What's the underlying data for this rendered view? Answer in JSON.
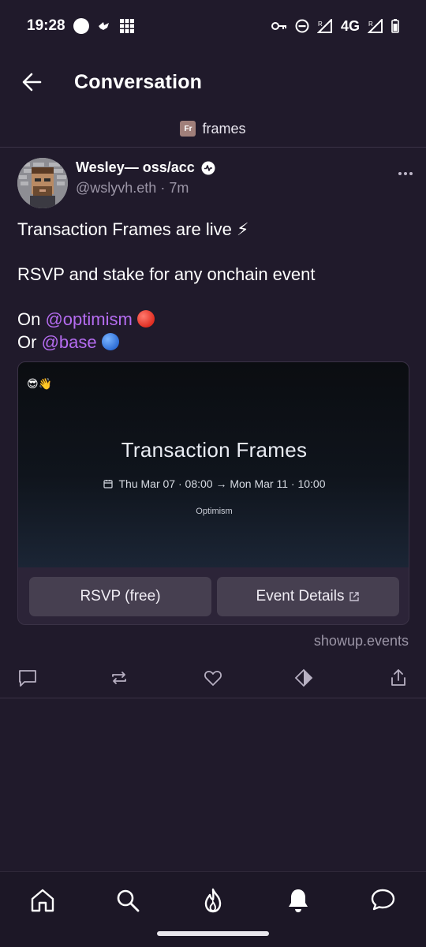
{
  "status_bar": {
    "time": "19:28",
    "network": "4G",
    "icons": [
      "circle-icon",
      "bird-icon",
      "grid-icon",
      "key-icon",
      "dnd-icon",
      "signal-icon",
      "signal-icon",
      "battery-icon"
    ]
  },
  "header": {
    "title": "Conversation",
    "back_icon": "arrow-left-icon"
  },
  "channel": {
    "badge": "Fr",
    "name": "frames"
  },
  "post": {
    "author_name": "Wesley— oss/acc",
    "author_handle": "@wslyvh.eth",
    "time_sep": " · ",
    "time_ago": "7m",
    "text_line1": "Transaction Frames are live ⚡",
    "text_line2": "RSVP and stake for any onchain event",
    "text_on": "On ",
    "mention1": "@optimism",
    "text_or": "Or ",
    "mention2": "@base"
  },
  "frame": {
    "emoji": "😎👋",
    "title": "Transaction Frames",
    "date": "Thu Mar 07 · 08:00 → Mon Mar 11 · 10:00",
    "chain": "Optimism",
    "button1": "RSVP (free)",
    "button2": "Event Details",
    "domain": "showup.events"
  },
  "colors": {
    "background": "#201a2b",
    "mention": "#b56cf0",
    "optimism_dot": "#e53e3e",
    "base_dot": "#3b7ddd"
  }
}
